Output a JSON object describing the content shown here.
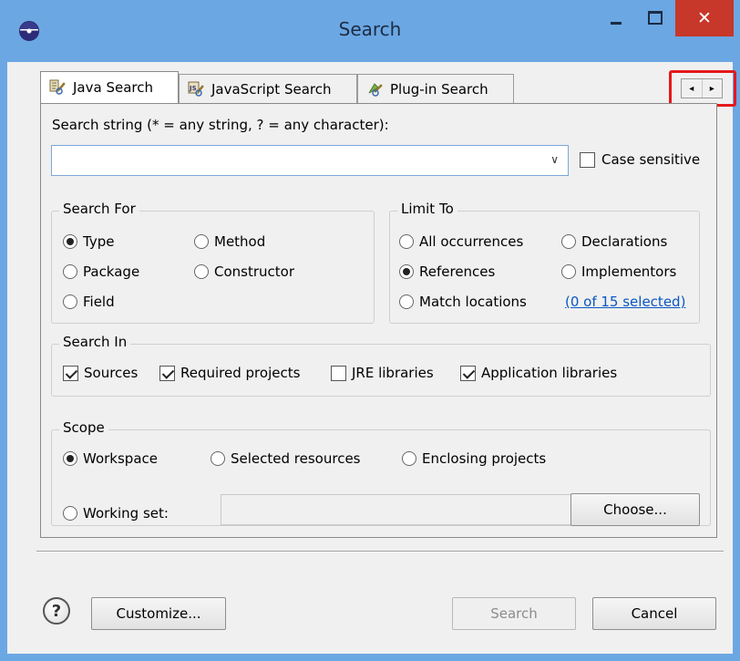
{
  "window": {
    "title": "Search",
    "close_glyph": "✕"
  },
  "tabs": [
    {
      "label": "Java Search",
      "icon": "java-search-icon",
      "active": true
    },
    {
      "label": "JavaScript Search",
      "icon": "javascript-search-icon",
      "active": false
    },
    {
      "label": "Plug-in Search",
      "icon": "plugin-search-icon",
      "active": false
    }
  ],
  "tab_scroll": {
    "left": "◂",
    "right": "▸",
    "highlight_color": "#e5181b"
  },
  "search_string": {
    "label": "Search string (* = any string, ? = any character):",
    "value": "",
    "case_sensitive_label": "Case sensitive",
    "case_sensitive_checked": false
  },
  "search_for": {
    "title": "Search For",
    "options": [
      {
        "label": "Type",
        "selected": true
      },
      {
        "label": "Method",
        "selected": false
      },
      {
        "label": "Package",
        "selected": false
      },
      {
        "label": "Constructor",
        "selected": false
      },
      {
        "label": "Field",
        "selected": false
      }
    ]
  },
  "limit_to": {
    "title": "Limit To",
    "options": [
      {
        "label": "All occurrences",
        "selected": false
      },
      {
        "label": "Declarations",
        "selected": false
      },
      {
        "label": "References",
        "selected": true
      },
      {
        "label": "Implementors",
        "selected": false
      },
      {
        "label": "Match locations",
        "selected": false
      }
    ],
    "selection_link": "(0 of 15 selected)"
  },
  "search_in": {
    "title": "Search In",
    "options": [
      {
        "label": "Sources",
        "checked": true
      },
      {
        "label": "Required projects",
        "checked": true
      },
      {
        "label": "JRE libraries",
        "checked": false
      },
      {
        "label": "Application libraries",
        "checked": true
      }
    ]
  },
  "scope": {
    "title": "Scope",
    "options": [
      {
        "label": "Workspace",
        "selected": true
      },
      {
        "label": "Selected resources",
        "selected": false
      },
      {
        "label": "Enclosing projects",
        "selected": false
      },
      {
        "label": "Working set:",
        "selected": false
      }
    ],
    "working_set_value": "",
    "choose_label": "Choose..."
  },
  "footer": {
    "help_glyph": "?",
    "customize_label": "Customize...",
    "search_label": "Search",
    "cancel_label": "Cancel"
  },
  "colors": {
    "titlebar": "#6ba7e3",
    "close": "#c7372a",
    "link": "#0a57c2"
  }
}
